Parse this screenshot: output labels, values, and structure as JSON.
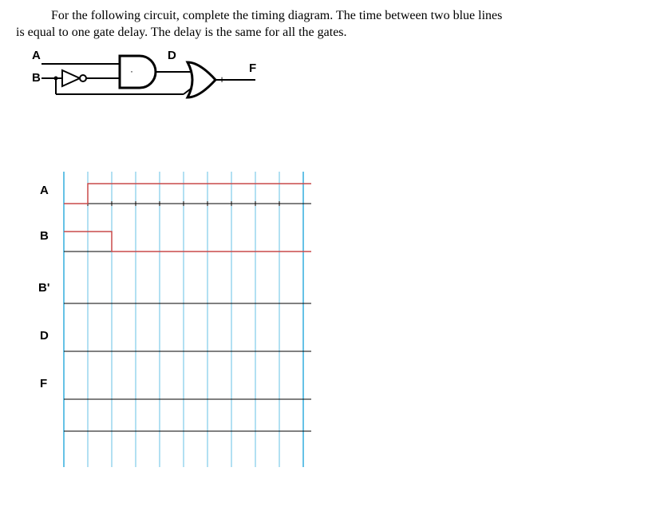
{
  "instruction": {
    "line1_prefix": "For the following circuit, complete the timing diagram. The time between two blue lines",
    "line2": "is equal to one gate delay. The delay is the same for all the gates."
  },
  "circuit_labels": {
    "A": "A",
    "B": "B",
    "D": "D",
    "F": "F",
    "plus": "+"
  },
  "timing_labels": {
    "A": "A",
    "B": "B",
    "Bprime": "B'",
    "D": "D",
    "F": "F"
  },
  "chart_data": {
    "type": "timing",
    "grid_columns": 11,
    "gate_delay_units": 1,
    "signals": [
      {
        "name": "A",
        "given": true,
        "initial": 0,
        "transitions": [
          {
            "t": 1,
            "to": 1
          }
        ]
      },
      {
        "name": "B",
        "given": true,
        "initial": 1,
        "transitions": [
          {
            "t": 2,
            "to": 0
          }
        ]
      },
      {
        "name": "B'",
        "given": false,
        "initial": null,
        "transitions": []
      },
      {
        "name": "D",
        "given": false,
        "initial": null,
        "transitions": []
      },
      {
        "name": "F",
        "given": false,
        "initial": null,
        "transitions": []
      }
    ],
    "colors": {
      "grid": "#66c2e6",
      "baseline": "#000000",
      "signal": "#c84a4a"
    }
  }
}
